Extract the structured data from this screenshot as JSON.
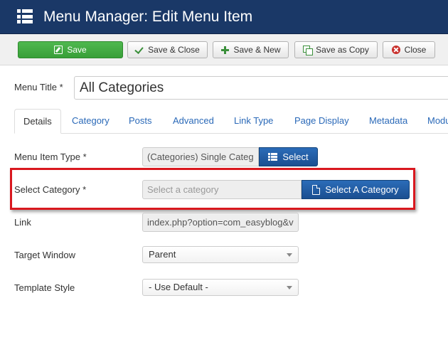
{
  "header": {
    "title": "Menu Manager: Edit Menu Item",
    "icon": "list-icon"
  },
  "toolbar": {
    "save": "Save",
    "save_close": "Save & Close",
    "save_new": "Save & New",
    "save_copy": "Save as Copy",
    "close": "Close"
  },
  "menu_title": {
    "label": "Menu Title *",
    "value": "All Categories"
  },
  "tabs": [
    {
      "label": "Details",
      "active": true
    },
    {
      "label": "Category"
    },
    {
      "label": "Posts"
    },
    {
      "label": "Advanced"
    },
    {
      "label": "Link Type"
    },
    {
      "label": "Page Display"
    },
    {
      "label": "Metadata"
    },
    {
      "label": "Modu"
    }
  ],
  "fields": {
    "menu_item_type": {
      "label": "Menu Item Type *",
      "value": "(Categories) Single Categ",
      "button": "Select"
    },
    "select_category": {
      "label": "Select Category *",
      "placeholder": "Select a category",
      "button": "Select A Category"
    },
    "link": {
      "label": "Link",
      "value": "index.php?option=com_easyblog&v"
    },
    "target_window": {
      "label": "Target Window",
      "selected": "Parent"
    },
    "template_style": {
      "label": "Template Style",
      "selected": "- Use Default -"
    }
  },
  "colors": {
    "header_bg": "#1a3867",
    "save_green": "#45ad45",
    "primary_blue": "#1f5aa0",
    "highlight_red": "#d9181f",
    "link_blue": "#2a69b8"
  }
}
